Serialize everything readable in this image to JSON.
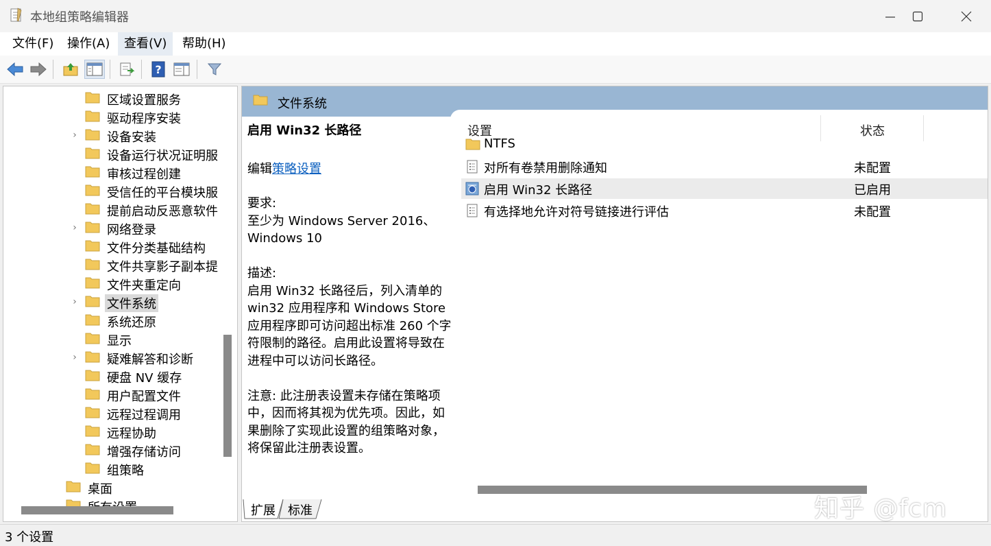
{
  "window": {
    "title": "本地组策略编辑器",
    "minimize_icon": "minimize-icon",
    "maximize_icon": "maximize-icon",
    "close_icon": "close-icon"
  },
  "menu": [
    "文件(F)",
    "操作(A)",
    "查看(V)",
    "帮助(H)"
  ],
  "toolbar": {
    "icons": [
      "back-arrow-icon",
      "forward-arrow-icon",
      "up-folder-icon",
      "show-hide-tree-icon",
      "export-list-icon",
      "help-icon",
      "properties-pane-icon",
      "filter-icon"
    ]
  },
  "tree": {
    "items": [
      {
        "label": "区域设置服务",
        "expandable": false
      },
      {
        "label": "驱动程序安装",
        "expandable": false
      },
      {
        "label": "设备安装",
        "expandable": true
      },
      {
        "label": "设备运行状况证明服",
        "expandable": false
      },
      {
        "label": "审核过程创建",
        "expandable": false
      },
      {
        "label": "受信任的平台模块服",
        "expandable": false
      },
      {
        "label": "提前启动反恶意软件",
        "expandable": false
      },
      {
        "label": "网络登录",
        "expandable": true
      },
      {
        "label": "文件分类基础结构",
        "expandable": false
      },
      {
        "label": "文件共享影子副本提",
        "expandable": false
      },
      {
        "label": "文件夹重定向",
        "expandable": false
      },
      {
        "label": "文件系统",
        "expandable": true,
        "selected": true
      },
      {
        "label": "系统还原",
        "expandable": false
      },
      {
        "label": "显示",
        "expandable": false
      },
      {
        "label": "疑难解答和诊断",
        "expandable": true
      },
      {
        "label": "硬盘 NV 缓存",
        "expandable": false
      },
      {
        "label": "用户配置文件",
        "expandable": false
      },
      {
        "label": "远程过程调用",
        "expandable": false
      },
      {
        "label": "远程协助",
        "expandable": false
      },
      {
        "label": "增强存储访问",
        "expandable": false
      },
      {
        "label": "组策略",
        "expandable": false
      }
    ],
    "parent_items": [
      {
        "label": "桌面"
      },
      {
        "label": "所有设置"
      }
    ]
  },
  "right": {
    "header_title": "文件系统",
    "desc": {
      "policy_title": "启用 Win32 长路径",
      "edit_prefix": "编辑",
      "edit_link": "策略设置",
      "requirements_label": "要求:",
      "requirements_text": "至少为 Windows Server 2016、Windows 10",
      "description_label": "描述:",
      "description_text": "启用 Win32 长路径后，列入清单的 win32 应用程序和 Windows Store 应用程序即可访问超出标准 260 个字符限制的路径。启用此设置将导致在进程中可以访问长路径。",
      "note_text": "注意: 此注册表设置未存储在策略项中，因而将其视为优先项。因此，如果删除了实现此设置的组策略对象，将保留此注册表设置。"
    },
    "columns": {
      "setting": "设置",
      "state": "状态"
    },
    "rows": [
      {
        "name": "NTFS",
        "state": "",
        "icon": "folder-icon"
      },
      {
        "name": "对所有卷禁用删除通知",
        "state": "未配置",
        "icon": "policy-setting-icon"
      },
      {
        "name": "启用 Win32 长路径",
        "state": "已启用",
        "icon": "policy-enabled-icon",
        "selected": true
      },
      {
        "name": "有选择地允许对符号链接进行评估",
        "state": "未配置",
        "icon": "policy-setting-icon"
      }
    ],
    "tabs": [
      "扩展",
      "标准"
    ]
  },
  "status": {
    "text": "3 个设置"
  },
  "watermark": "知乎 @fcm",
  "colors": {
    "header_blue": "#99b6d3",
    "link": "#0b5fbf",
    "folder": "#f2c85b"
  }
}
